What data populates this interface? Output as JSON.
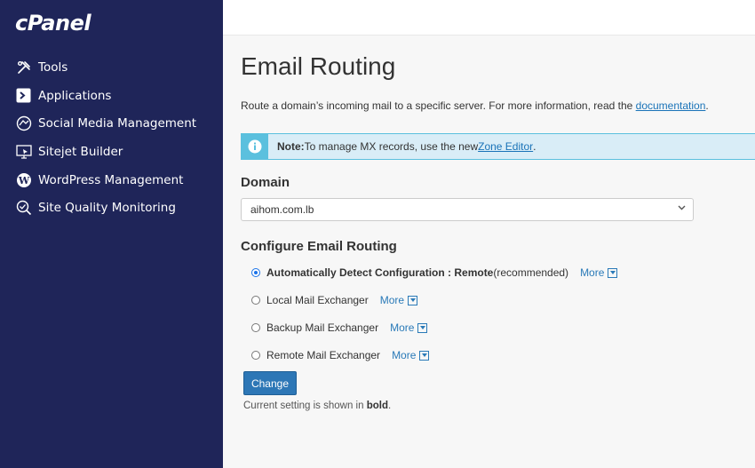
{
  "brand": {
    "logo_text": "cPanel"
  },
  "sidebar": {
    "items": [
      {
        "label": "Tools",
        "icon": "tools-icon"
      },
      {
        "label": "Applications",
        "icon": "applications-icon"
      },
      {
        "label": "Social Media Management",
        "icon": "social-media-icon"
      },
      {
        "label": "Sitejet Builder",
        "icon": "sitejet-icon"
      },
      {
        "label": "WordPress Management",
        "icon": "wordpress-icon"
      },
      {
        "label": "Site Quality Monitoring",
        "icon": "site-quality-icon"
      }
    ]
  },
  "page": {
    "title": "Email Routing",
    "description_prefix": "Route a domain’s incoming mail to a specific server. For more information, read the ",
    "description_link": "documentation",
    "description_suffix": "."
  },
  "note": {
    "label": "Note:",
    "text": " To manage MX records, use the new ",
    "link": "Zone Editor",
    "suffix": "."
  },
  "domain": {
    "heading": "Domain",
    "selected": "aihom.com.lb"
  },
  "routing": {
    "heading": "Configure Email Routing",
    "options": [
      {
        "label": "Automatically Detect Configuration : Remote",
        "suffix": " (recommended)",
        "checked": true,
        "more": "More"
      },
      {
        "label": "Local Mail Exchanger",
        "suffix": "",
        "checked": false,
        "more": "More"
      },
      {
        "label": "Backup Mail Exchanger",
        "suffix": "",
        "checked": false,
        "more": "More"
      },
      {
        "label": "Remote Mail Exchanger",
        "suffix": "",
        "checked": false,
        "more": "More"
      }
    ],
    "change_button": "Change",
    "footnote_prefix": "Current setting is shown in ",
    "footnote_bold": "bold",
    "footnote_suffix": "."
  },
  "colors": {
    "sidebar": "#1f2559",
    "accent": "#2d77b6",
    "note_bg": "#d9edf7",
    "note_border": "#5bc0de"
  }
}
